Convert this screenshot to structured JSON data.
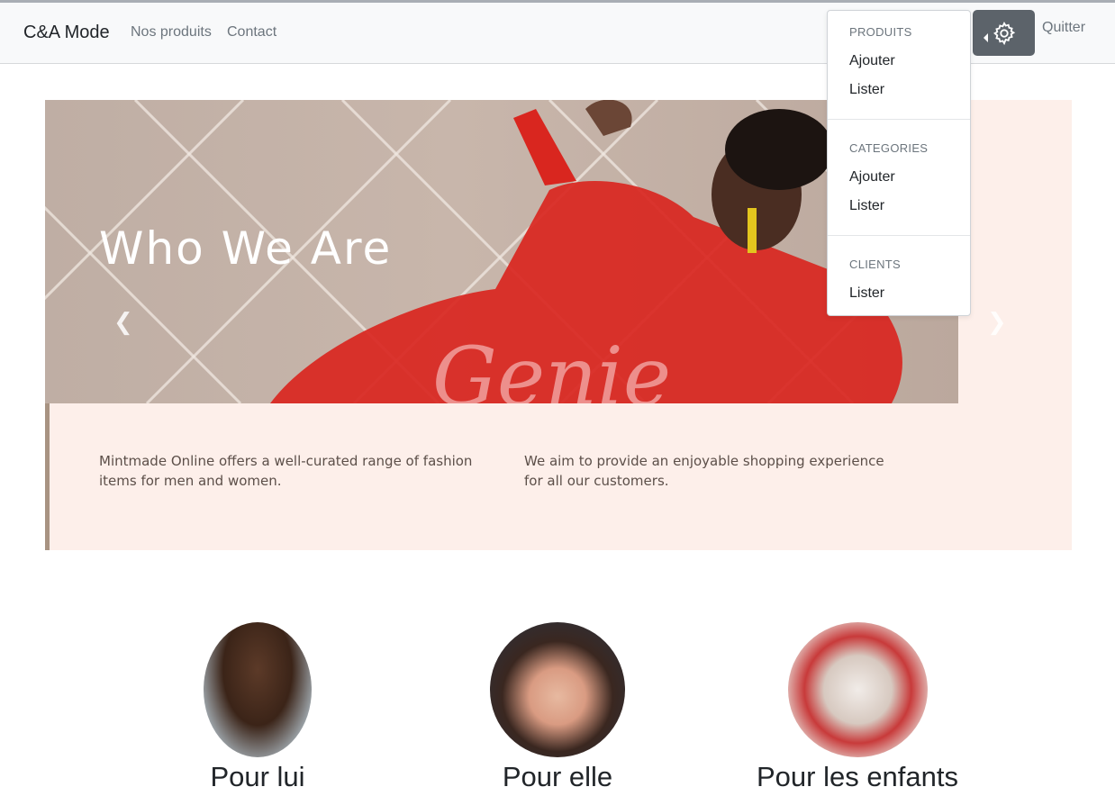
{
  "navbar": {
    "brand": "C&A Mode",
    "links": [
      "Nos produits",
      "Contact"
    ],
    "settings_icon": "gear-icon",
    "quit_label": "Quitter"
  },
  "dropdown": {
    "sections": [
      {
        "header": "PRODUITS",
        "items": [
          "Ajouter",
          "Lister"
        ]
      },
      {
        "header": "CATEGORIES",
        "items": [
          "Ajouter",
          "Lister"
        ]
      },
      {
        "header": "CLIENTS",
        "items": [
          "Lister"
        ]
      }
    ]
  },
  "hero": {
    "title": "Who We Are",
    "text_left": "Mintmade Online offers a well-curated range of fashion items for men and women.",
    "text_right": "We aim to provide an enjoyable shopping experience for all our customers.",
    "prev_icon": "chevron-left-icon",
    "next_icon": "chevron-right-icon"
  },
  "categories": [
    {
      "title": "Pour lui"
    },
    {
      "title": "Pour elle"
    },
    {
      "title": "Pour les enfants"
    }
  ]
}
